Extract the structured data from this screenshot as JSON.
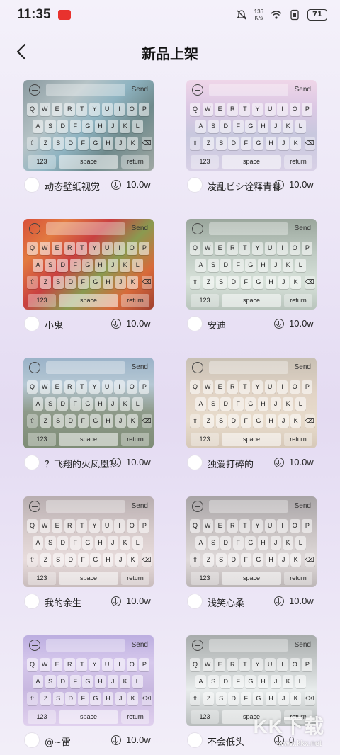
{
  "status_bar": {
    "time": "11:35",
    "net_speed_value": "136",
    "net_speed_unit": "K/s",
    "battery": "71"
  },
  "header": {
    "title": "新品上架"
  },
  "keyboard": {
    "send_label": "Send",
    "row1": [
      "Q",
      "W",
      "E",
      "R",
      "T",
      "Y",
      "U",
      "I",
      "O",
      "P"
    ],
    "row2": [
      "A",
      "S",
      "D",
      "F",
      "G",
      "H",
      "J",
      "K",
      "L"
    ],
    "row3": [
      "Z",
      "S",
      "D",
      "F",
      "G",
      "H",
      "J",
      "K"
    ],
    "num_label": "123",
    "space_label": "space",
    "return_label": "return"
  },
  "skins": [
    {
      "name": "动态壁纸视觉",
      "count": "10.0w",
      "bg": "linear-gradient(135deg,#8a9aa0 0%,#b6c3c6 30%,#8fb4c2 50%,#6f8a8c 70%,#a0a8a4 100%)"
    },
    {
      "name": "凌乱ビシ诠释青春",
      "count": "10.0w",
      "bg": "linear-gradient(180deg,#efd6e8 0%,#dcc8e4 30%,#c8c8de 60%,#d8d0e6 100%)"
    },
    {
      "name": "小鬼",
      "count": "10.0w",
      "bg": "linear-gradient(135deg,#d8503a 0%,#e27a40 20%,#c94040 40%,#8a9a50 60%,#d86a3a 80%,#a04030 100%)"
    },
    {
      "name": "安迪",
      "count": "10.0w",
      "bg": "linear-gradient(180deg,#9aa69c 0%,#c0ccc4 40%,#d8e2da 70%,#b8c4bc 100%)"
    },
    {
      "name": "？飞翔的火凤凰？",
      "count": "10.0w",
      "bg": "linear-gradient(180deg,#9ab2c8 0%,#b6c8d4 30%,#8e9a8a 60%,#7e8c76 100%)"
    },
    {
      "name": "独爱打碎的",
      "count": "10.0w",
      "bg": "linear-gradient(180deg,#c8c0b4 0%,#e2d4c6 40%,#e8dccc 70%,#d6c8b8 100%)"
    },
    {
      "name": "我的余生",
      "count": "10.0w",
      "bg": "linear-gradient(180deg,#b8aeb0 0%,#d8cccc 40%,#e8dcdc 70%,#c8bcbc 100%)"
    },
    {
      "name": "浅笑心柔",
      "count": "10.0w",
      "bg": "linear-gradient(180deg,#a8a4a6 0%,#cac4c4 40%,#e0dada 70%,#bcb6b6 100%)"
    },
    {
      "name": "@~雷",
      "count": "10.0w",
      "bg": "linear-gradient(180deg,#bcaee0 0%,#d6c8ec 30%,#c8b8e0 60%,#e0d0ee 100%)"
    },
    {
      "name": "不会低头",
      "count": "0",
      "bg": "linear-gradient(180deg,#a8acac 0%,#d0d4d4 40%,#e8ecec 60%,#b8bcbc 100%)"
    }
  ],
  "watermark": {
    "logo_text": "KK下载",
    "url": "www.kkx.net"
  },
  "colors": {
    "accent_badge": "#e8322e",
    "background": "#ece6f6"
  }
}
